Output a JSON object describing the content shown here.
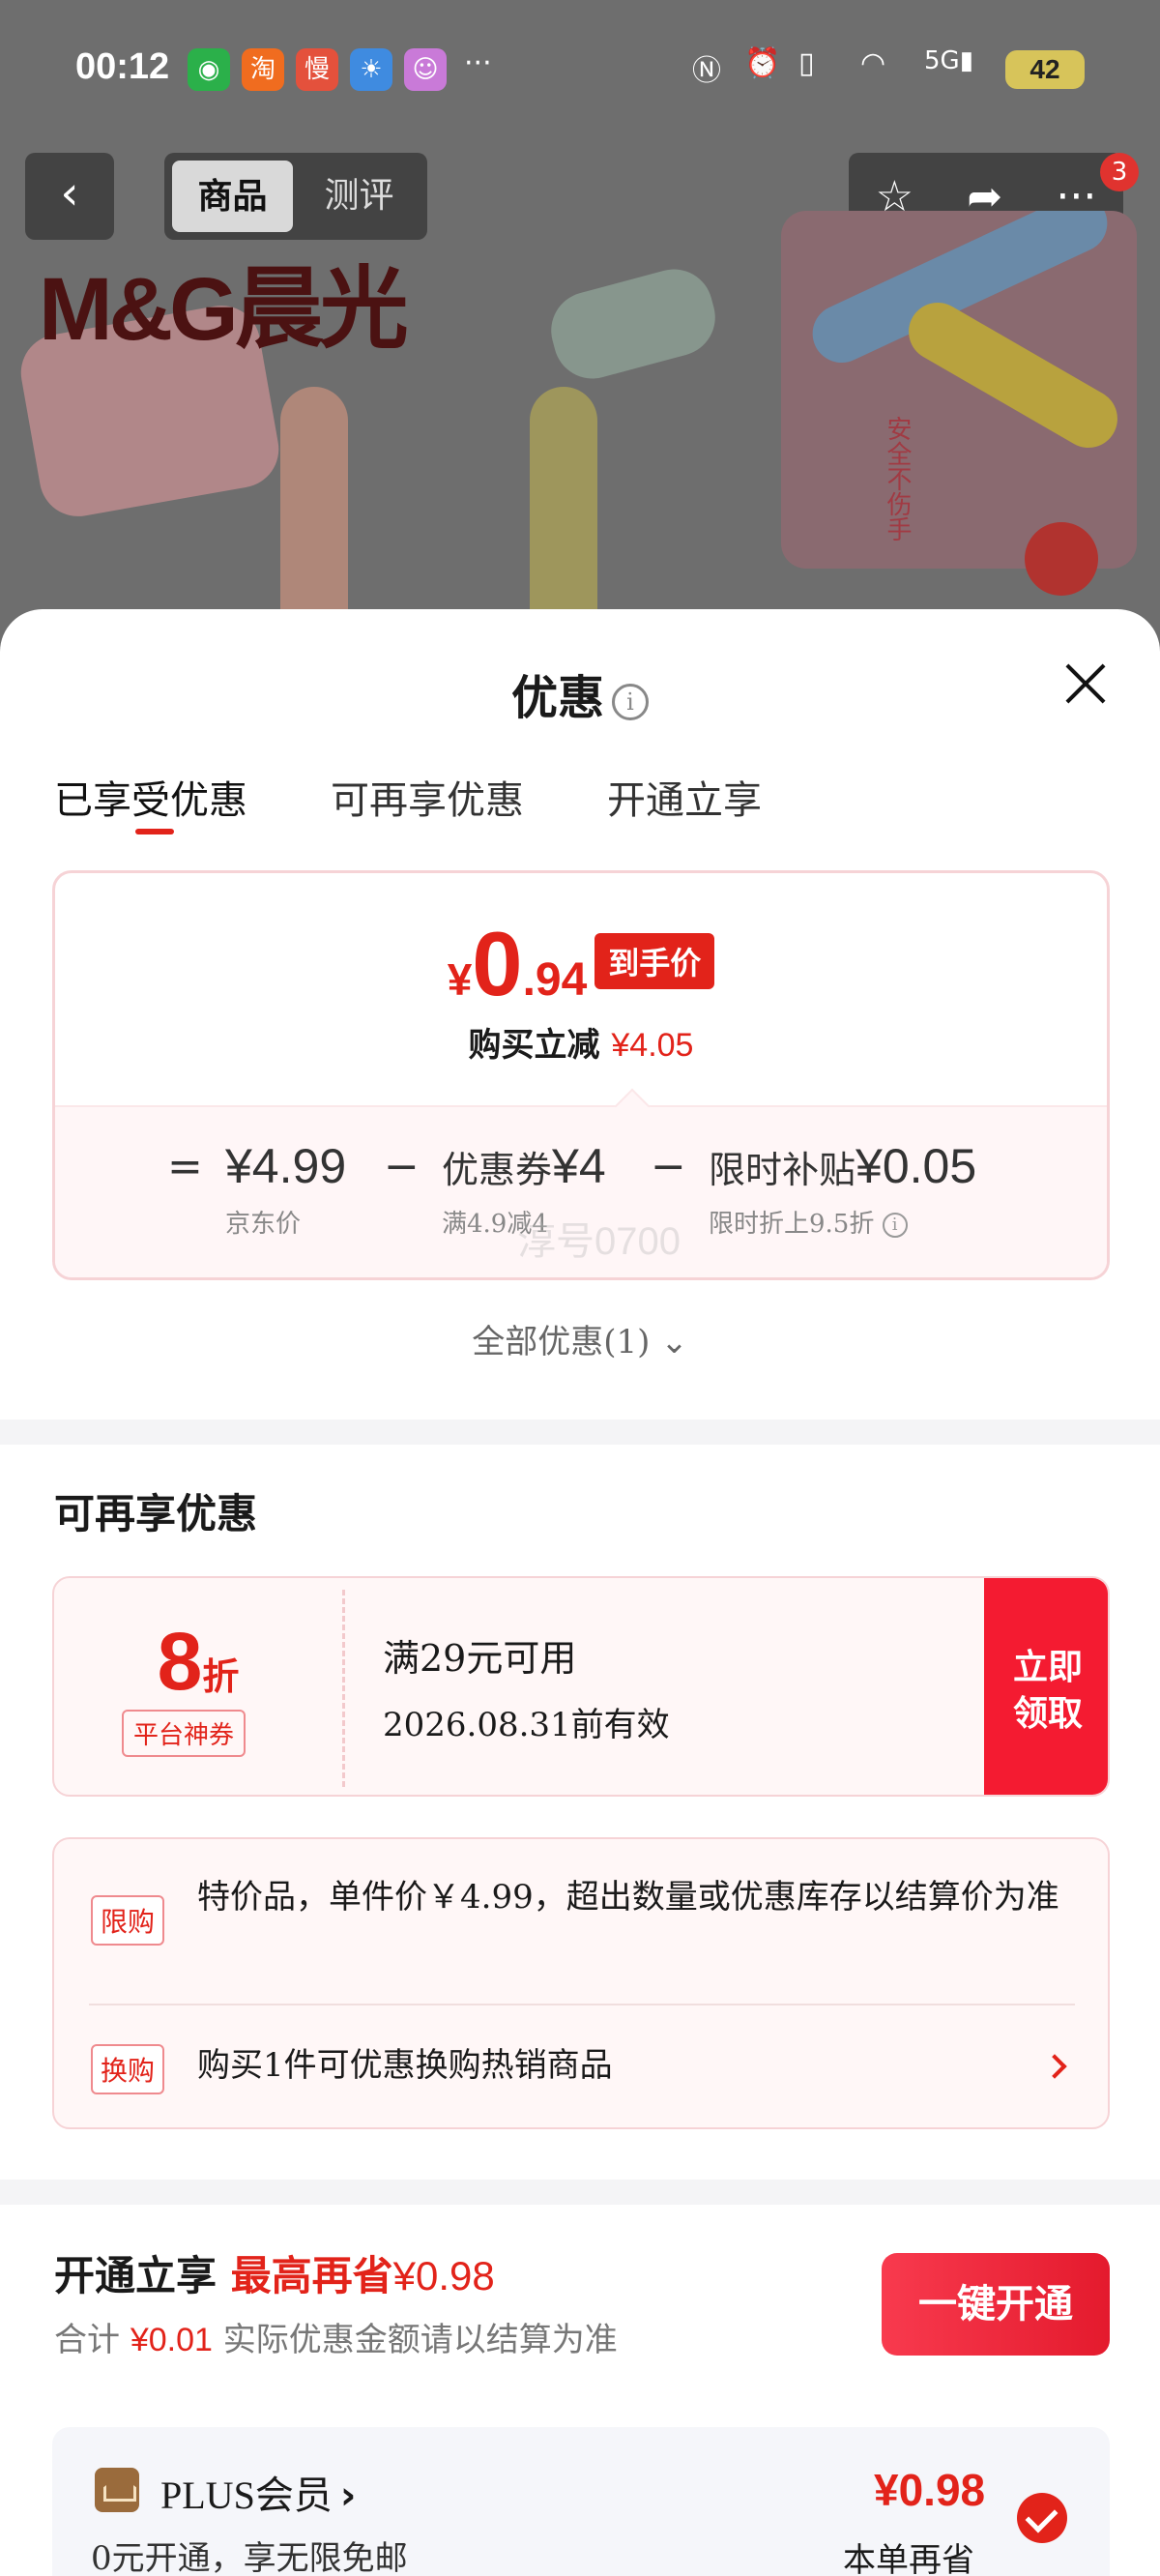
{
  "status_bar": {
    "time": "00:12",
    "battery": "42",
    "more_dots": "···",
    "app_icons": [
      "wechat-icon",
      "taobao-icon",
      "man-icon",
      "weather-icon",
      "app-icon"
    ]
  },
  "product_header": {
    "tabs": [
      "商品",
      "测评"
    ],
    "badge_count": "3",
    "brand": "M&G晨光",
    "thumb_caption": "安全不伤手"
  },
  "sheet": {
    "title": "优惠",
    "tabs": [
      "已享受优惠",
      "可再享优惠",
      "开通立享"
    ],
    "price": {
      "currency": "¥",
      "integer": "0",
      "decimal": ".94",
      "tag": "到手价",
      "reduce_label": "购买立减",
      "reduce_amount": "¥4.05"
    },
    "breakdown": {
      "equals": "=",
      "minus": "−",
      "jd_price": "¥4.99",
      "jd_note": "京东价",
      "coupon_label": "优惠券",
      "coupon_amount": "¥4",
      "coupon_note": "满4.9减4",
      "subsidy_label": "限时补贴",
      "subsidy_amount": "¥0.05",
      "subsidy_note": "限时折上9.5折",
      "watermark": "淳号0700"
    },
    "all_offers": "全部优惠(1)",
    "more_section": {
      "title": "可再享优惠",
      "coupon": {
        "discount": "8",
        "unit": "折",
        "type": "平台神券",
        "condition": "满29元可用",
        "expiry": "2026.08.31前有效",
        "claim": "立即领取"
      },
      "notice": {
        "limit_tag": "限购",
        "limit_text": "特价品，单件价￥4.99，超出数量或优惠库存以结算价为准",
        "swap_tag": "换购",
        "swap_text": "购买1件可优惠换购热销商品"
      }
    },
    "plus_section": {
      "title": "开通立享",
      "highlight": "最高再省",
      "highlight_amount": "¥0.98",
      "sub_prefix": "合计",
      "sub_amount": "¥0.01",
      "sub_suffix": "实际优惠金额请以结算为准",
      "button": "一键开通",
      "member_name": "PLUS会员",
      "member_desc": "0元开通，享无限免邮",
      "member_amount": "¥0.98",
      "member_save": "本单再省"
    }
  },
  "colors": {
    "accent": "#e2231a",
    "claim_bg": "#f41b31"
  }
}
